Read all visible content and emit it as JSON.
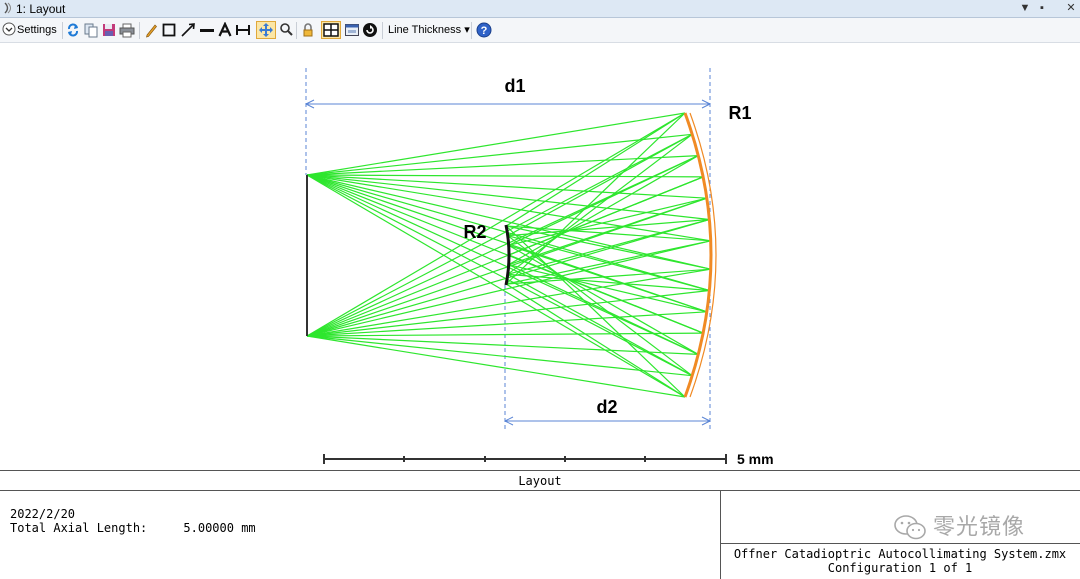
{
  "window": {
    "title": "1: Layout",
    "controls": [
      "dropdown-arrow",
      "restore-icon",
      "close-icon"
    ]
  },
  "toolbar": {
    "settings_label": "Settings",
    "line_thickness_label": "Line Thickness ▾",
    "icons": [
      "settings-chevron-icon",
      "refresh-icon",
      "copy-icon",
      "save-icon",
      "print-icon",
      "pencil-icon",
      "rectangle-icon",
      "arrow-icon",
      "line-icon",
      "text-icon",
      "dimension-icon",
      "pan-icon",
      "zoom-icon",
      "lock-icon",
      "window-layout-icon",
      "window-icon",
      "rotate-icon",
      "help-icon"
    ]
  },
  "plot": {
    "labels": {
      "d1": "d1",
      "d2": "d2",
      "r1": "R1",
      "r2": "R2"
    },
    "scale_bar": "5 mm",
    "colors": {
      "rays": "#2ee62e",
      "mirror_r1": "#f08a24",
      "mirror_r2": "#111111",
      "dimension": "#5b86d6"
    }
  },
  "footer": {
    "title": "Layout",
    "date": "2022/2/20",
    "axial_length": "Total Axial Length:     5.00000 mm",
    "file_name": "Offner Catadioptric Autocollimating System.zmx",
    "configuration": "Configuration 1 of 1"
  },
  "watermark": {
    "text": "零光镜像"
  }
}
